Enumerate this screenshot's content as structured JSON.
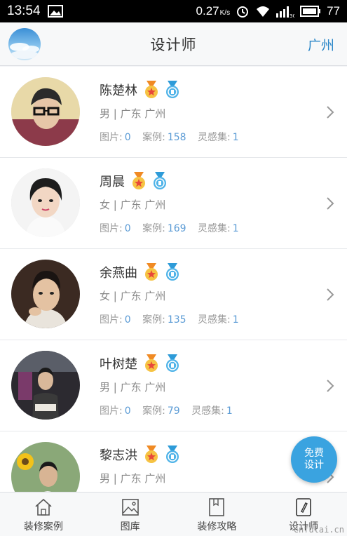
{
  "status_bar": {
    "time": "13:54",
    "speed": "0.27",
    "speed_unit": "K/s",
    "network": "3G",
    "battery": "77"
  },
  "header": {
    "title": "设计师",
    "city": "广州"
  },
  "designers": [
    {
      "name": "陈楚林",
      "gender": "男",
      "location": "广东  广州",
      "pictures": "0",
      "cases": "158",
      "inspirations": "1"
    },
    {
      "name": "周晨",
      "gender": "女",
      "location": "广东  广州",
      "pictures": "0",
      "cases": "169",
      "inspirations": "1"
    },
    {
      "name": "余燕曲",
      "gender": "女",
      "location": "广东  广州",
      "pictures": "0",
      "cases": "135",
      "inspirations": "1"
    },
    {
      "name": "叶树楚",
      "gender": "男",
      "location": "广东  广州",
      "pictures": "0",
      "cases": "79",
      "inspirations": "1"
    },
    {
      "name": "黎志洪",
      "gender": "男",
      "location": "广东  广州",
      "pictures": "",
      "cases": "",
      "inspirations": ""
    }
  ],
  "labels": {
    "pictures": "图片:",
    "cases": "案例:",
    "inspirations": "灵感集:",
    "separator": "|"
  },
  "fab": {
    "line1": "免费",
    "line2": "设计"
  },
  "tabs": [
    {
      "label": "装修案例",
      "icon": "house-icon"
    },
    {
      "label": "图库",
      "icon": "picture-icon"
    },
    {
      "label": "装修攻略",
      "icon": "bookmark-book-icon"
    },
    {
      "label": "设计师",
      "icon": "pencil-icon"
    }
  ],
  "watermark": "cnfulai.cn",
  "colors": {
    "accent": "#2a86c8",
    "value": "#5b9bd5",
    "fab": "#3aa3e0"
  }
}
